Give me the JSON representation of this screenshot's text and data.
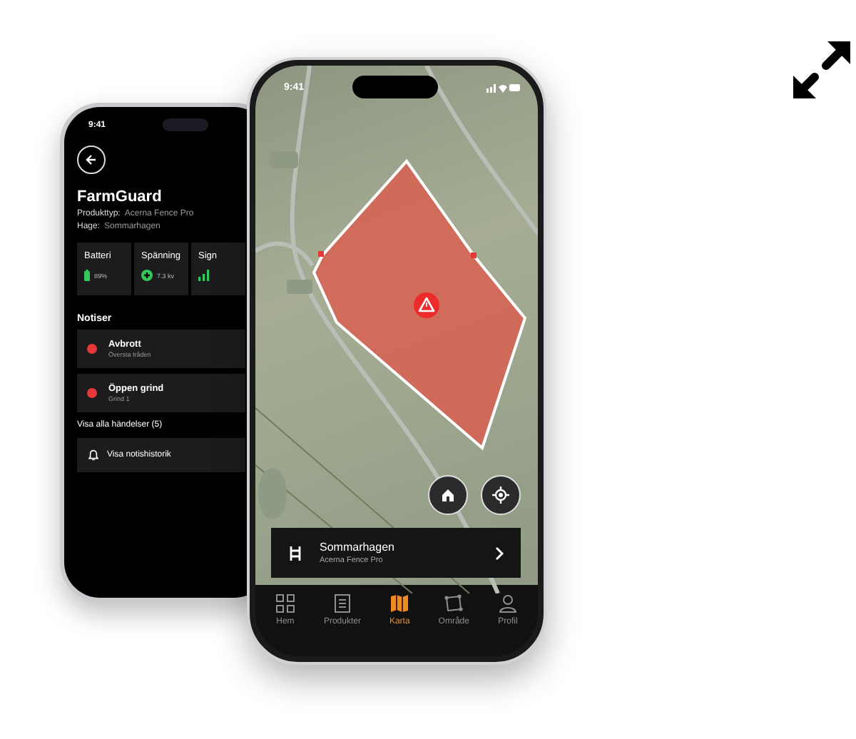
{
  "back_phone": {
    "status_time": "9:41",
    "title": "FarmGuard",
    "details": [
      {
        "label": "Produkttyp:",
        "value": "Acerna Fence Pro"
      },
      {
        "label": "Hage:",
        "value": "Sommarhagen"
      }
    ],
    "stats": [
      {
        "kind": "battery",
        "label": "Batteri",
        "value": "89%"
      },
      {
        "kind": "voltage",
        "label": "Spänning",
        "value": "7.3 kv"
      },
      {
        "kind": "signal",
        "label": "Sign"
      }
    ],
    "notices_heading": "Notiser",
    "notices": [
      {
        "title": "Avbrott",
        "subtitle": "Översta tråden"
      },
      {
        "title": "Öppen grind",
        "subtitle": "Grind 1"
      }
    ],
    "all_events_link": "Visa alla händelser (5)",
    "history_button": "Visa notishistorik"
  },
  "front_phone": {
    "status_time": "9:41",
    "area_card": {
      "title": "Sommarhagen",
      "subtitle": "Acerna Fence Pro"
    },
    "tabs": [
      {
        "kind": "grid",
        "label": "Hem",
        "selected": false
      },
      {
        "kind": "list",
        "label": "Produkter",
        "selected": false
      },
      {
        "kind": "map",
        "label": "Karta",
        "selected": true
      },
      {
        "kind": "area",
        "label": "Område",
        "selected": false
      },
      {
        "kind": "person",
        "label": "Profil",
        "selected": false
      }
    ]
  }
}
